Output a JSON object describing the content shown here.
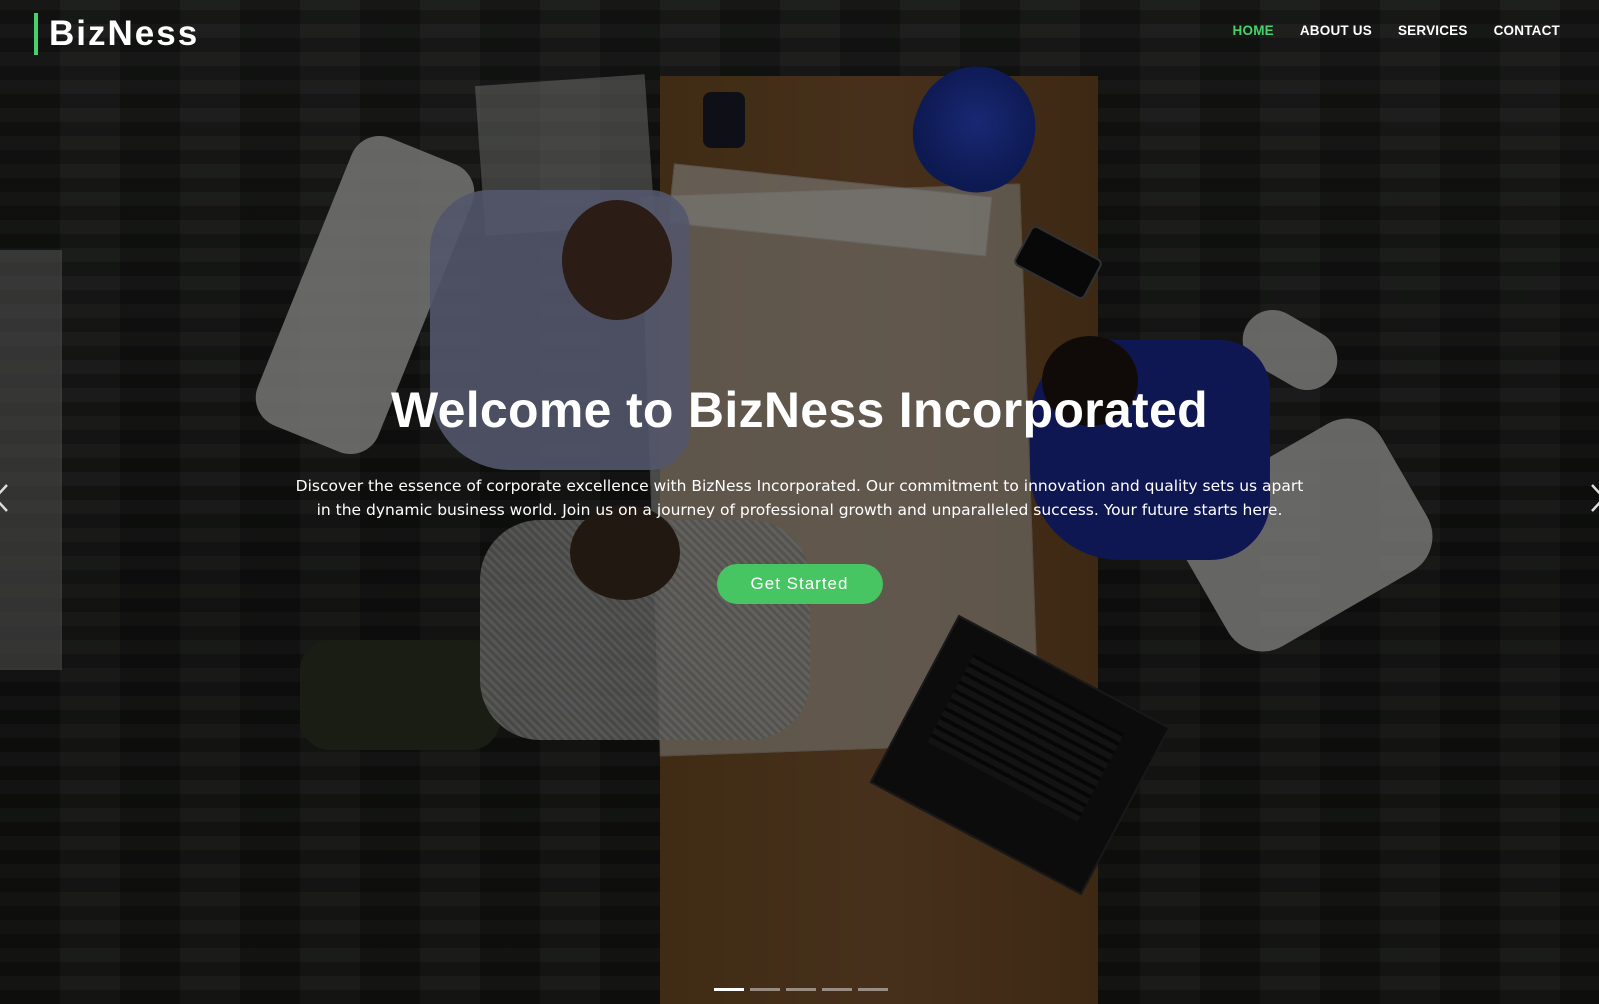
{
  "header": {
    "logo": "BizNess",
    "nav": [
      {
        "label": "HOME",
        "active": true
      },
      {
        "label": "ABOUT US",
        "active": false
      },
      {
        "label": "SERVICES",
        "active": false
      },
      {
        "label": "CONTACT",
        "active": false
      }
    ]
  },
  "hero": {
    "title": "Welcome to BizNess Incorporated",
    "text": "Discover the essence of corporate excellence with BizNess Incorporated. Our commitment to innovation and quality sets us apart in the dynamic business world. Join us on a journey of professional growth and unparalleled success. Your future starts here.",
    "cta_label": "Get Started"
  },
  "carousel": {
    "slide_count": 5,
    "active_index": 0,
    "prev_icon": "chevron-left-icon",
    "next_icon": "chevron-right-icon"
  },
  "colors": {
    "accent": "#47d16d",
    "button": "#47c563",
    "text": "#ffffff"
  }
}
